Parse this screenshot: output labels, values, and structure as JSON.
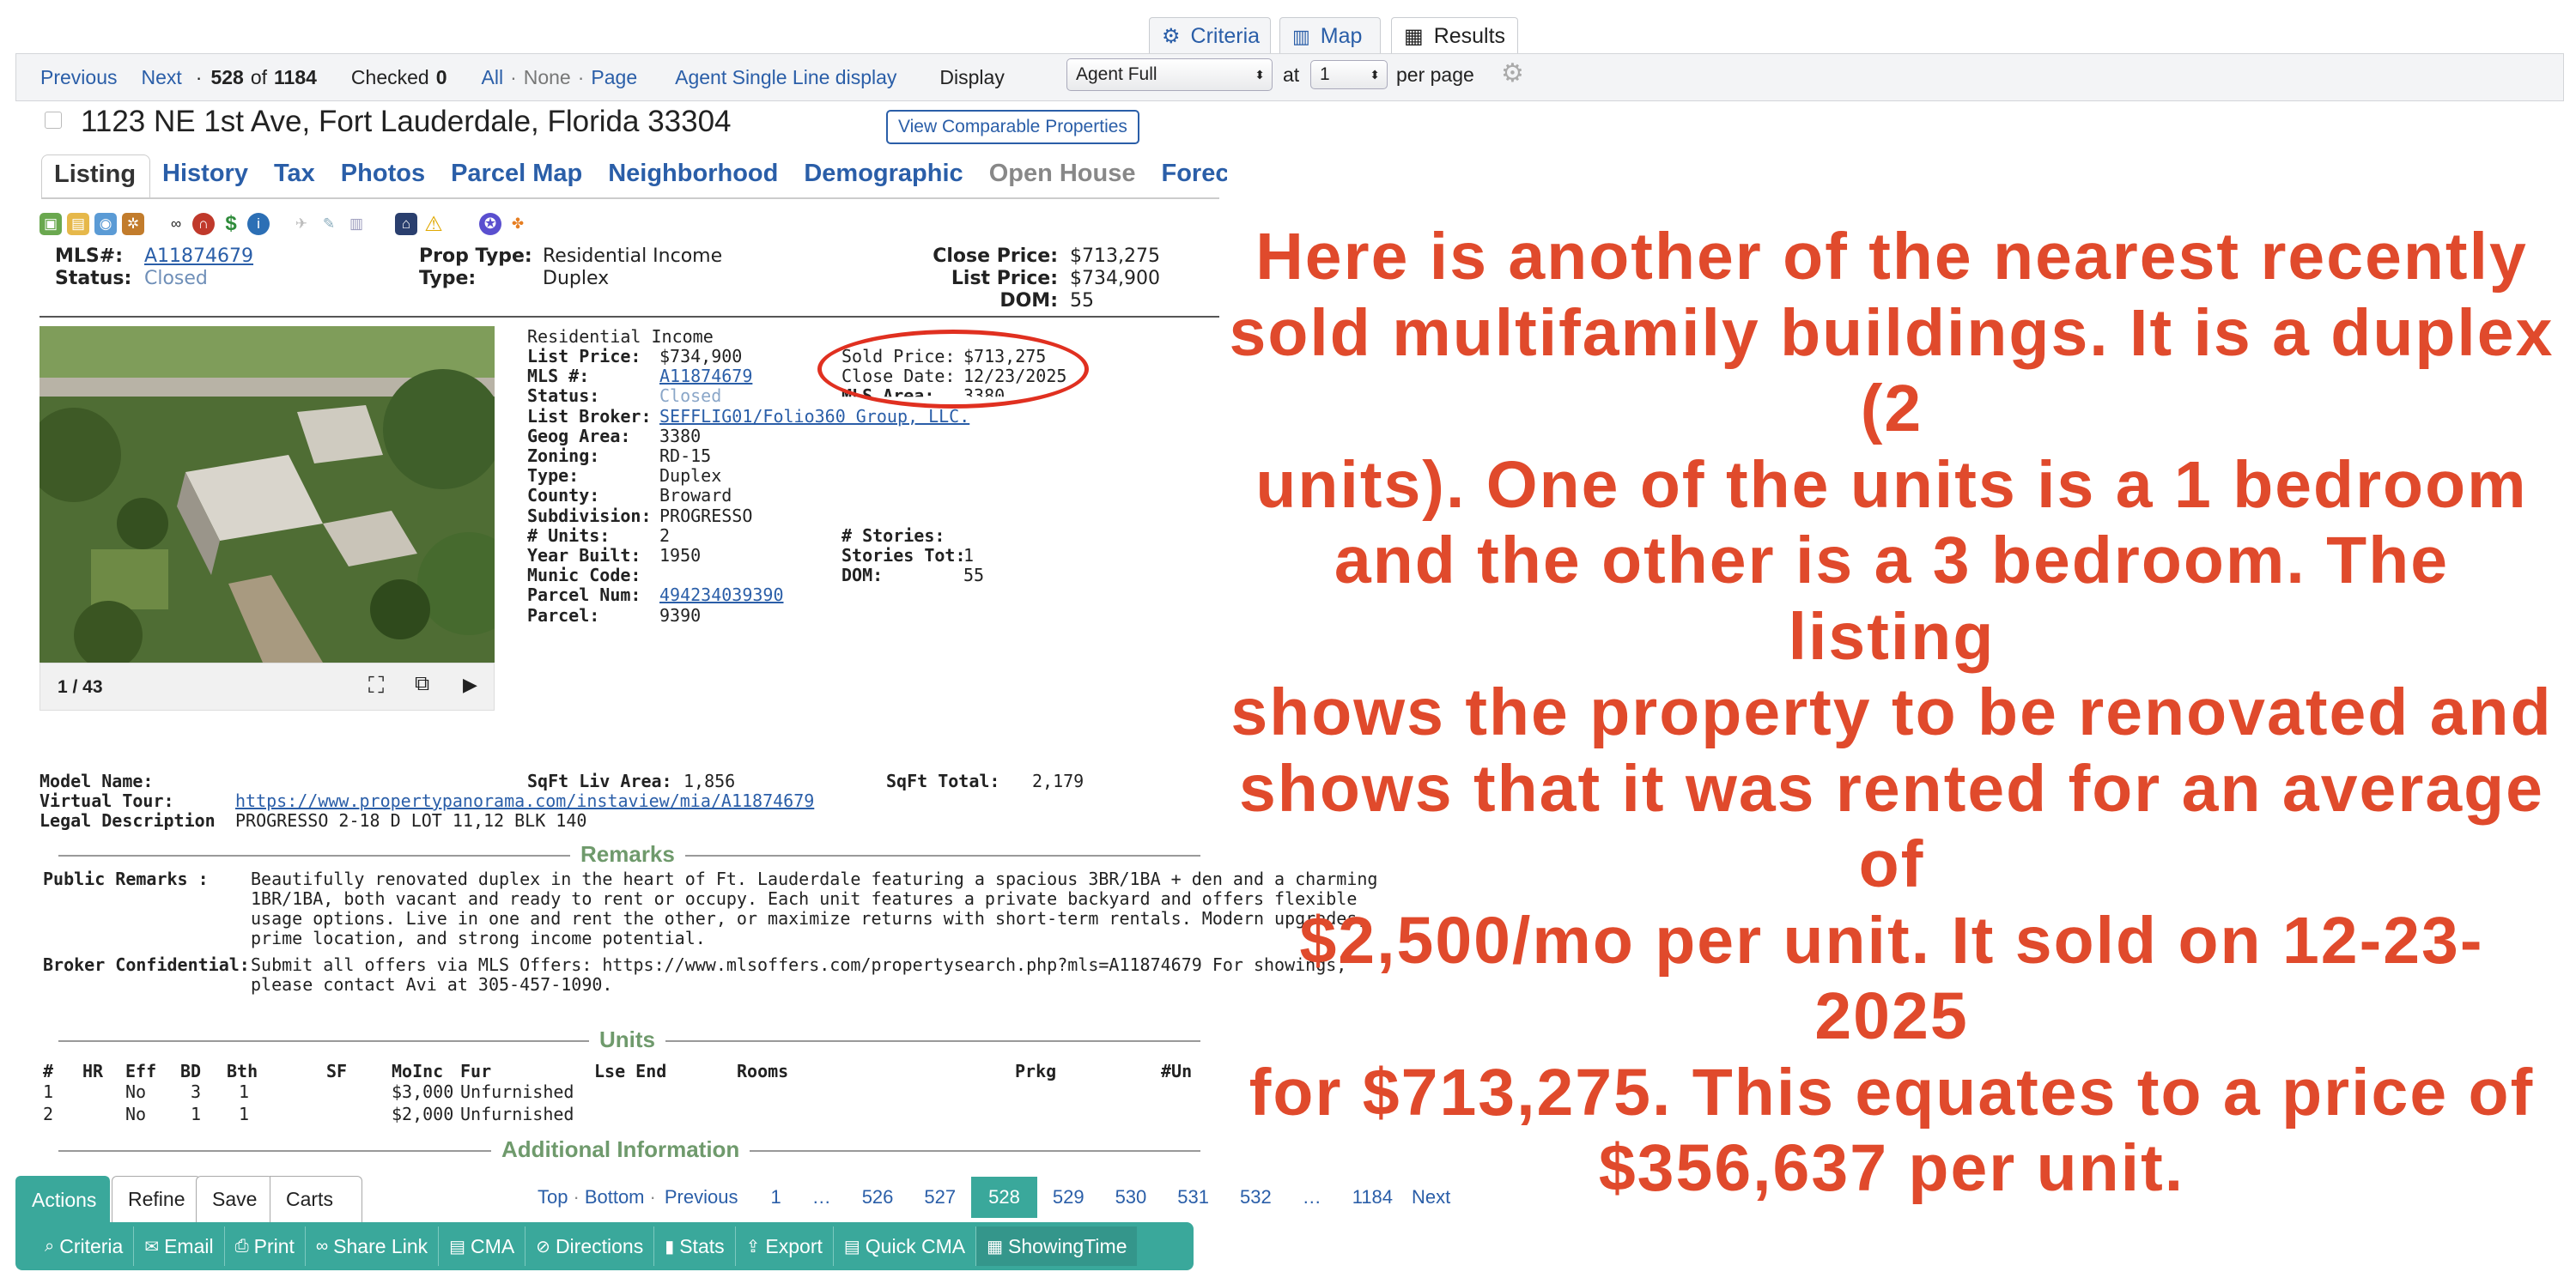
{
  "top_tabs": [
    {
      "label": "Criteria",
      "icon": "sliders-icon"
    },
    {
      "label": "Map",
      "icon": "map-icon"
    },
    {
      "label": "Results",
      "icon": "table-icon"
    }
  ],
  "toolbar": {
    "previous": "Previous",
    "next": "Next",
    "dot": "·",
    "position": "528",
    "of": "of",
    "total": "1184",
    "checked_label": "Checked",
    "checked_count": "0",
    "all": "All",
    "none": "None",
    "page": "Page",
    "sep": "·",
    "agent_single": "Agent Single Line display",
    "display_label": "Display",
    "display_value": "Agent Full",
    "at_label": "at",
    "per_page_value": "1",
    "per_page_label": "per page"
  },
  "property": {
    "address": "1123 NE 1st Ave, Fort Lauderdale, Florida 33304",
    "compare_button": "View Comparable Properties"
  },
  "property_tabs": [
    "Listing",
    "History",
    "Tax",
    "Photos",
    "Parcel Map",
    "Neighborhood",
    "Demographic",
    "Open House",
    "Foreclo"
  ],
  "summary": {
    "mls_label": "MLS#:",
    "mls_value": "A11874679",
    "status_label": "Status:",
    "status_value": "Closed",
    "proptype_label": "Prop Type:",
    "proptype_value": "Residential Income",
    "type_label": "Type:",
    "type_value": "Duplex",
    "close_price_label": "Close Price:",
    "close_price_value": "$713,275",
    "list_price_label": "List Price:",
    "list_price_value": "$734,900",
    "dom_label": "DOM:",
    "dom_value": "55"
  },
  "photo": {
    "counter": "1 / 43"
  },
  "details": {
    "category": "Residential Income",
    "left": [
      {
        "label": "List Price:",
        "value": "$734,900"
      },
      {
        "label": "MLS #:",
        "value": "A11874679",
        "link": true
      },
      {
        "label": "Status:",
        "value": "Closed",
        "muted": true
      },
      {
        "label": "List Broker:",
        "value": "SEFFLIG01/Folio360 Group, LLC.",
        "link": true
      },
      {
        "label": "Geog Area:",
        "value": "3380"
      },
      {
        "label": "Zoning:",
        "value": "RD-15"
      },
      {
        "label": "Type:",
        "value": "Duplex"
      },
      {
        "label": "County:",
        "value": "Broward"
      },
      {
        "label": "Subdivision:",
        "value": "PROGRESSO"
      },
      {
        "label": "# Units:",
        "value": "2"
      },
      {
        "label": "Year Built:",
        "value": "1950"
      },
      {
        "label": "Munic Code:",
        "value": ""
      },
      {
        "label": "Parcel Num:",
        "value": "494234039390",
        "link": true
      },
      {
        "label": "Parcel:",
        "value": "9390"
      }
    ],
    "sold_price_label": "Sold Price:",
    "sold_price_value": "$713,275",
    "close_date_label": "Close Date:",
    "close_date_value": "12/23/2025",
    "mls_area_label": "MLS Area:",
    "mls_area_value": "3380",
    "stories_label": "# Stories:",
    "stories_value": "",
    "stories_tot_label": "Stories Tot:",
    "stories_tot_value": "1",
    "dom_label": "DOM:",
    "dom_value": "55"
  },
  "extra": {
    "model_label": "Model Name:",
    "model_value": "",
    "tour_label": "Virtual Tour:",
    "tour_value": "https://www.propertypanorama.com/instaview/mia/A11874679",
    "legal_label": "Legal Description",
    "legal_value": "PROGRESSO 2-18 D LOT 11,12 BLK 140",
    "sqft_liv_label": "SqFt Liv Area:",
    "sqft_liv_value": "1,856",
    "sqft_total_label": "SqFt Total:",
    "sqft_total_value": "2,179"
  },
  "remarks": {
    "title": "Remarks",
    "public_label": "Public Remarks :",
    "public_lines": [
      "Beautifully renovated duplex in the heart of Ft. Lauderdale featuring a spacious 3BR/1BA + den and a charming",
      "1BR/1BA, both vacant and ready to rent or occupy. Each unit features a private backyard and offers flexible",
      "usage options. Live in one and rent the other, or maximize returns with short-term rentals. Modern upgrades,",
      "prime location, and strong income potential."
    ],
    "broker_label": "Broker Confidential:",
    "broker_lines": [
      "Submit all offers via MLS Offers: https://www.mlsoffers.com/propertysearch.php?mls=A11874679 For showings,",
      "please contact Avi at 305-457-1090."
    ]
  },
  "units": {
    "title": "Units",
    "headers": [
      "#",
      "HR",
      "Eff",
      "BD",
      "Bth",
      "SF",
      "MoInc",
      "Fur",
      "Lse End",
      "Rooms",
      "Prkg",
      "#Un"
    ],
    "rows": [
      [
        "1",
        "",
        "No",
        "3",
        "1",
        "",
        "$3,000",
        "Unfurnished",
        "",
        "",
        "",
        ""
      ],
      [
        "2",
        "",
        "No",
        "1",
        "1",
        "",
        "$2,000",
        "Unfurnished",
        "",
        "",
        "",
        ""
      ]
    ]
  },
  "additional": {
    "title": "Additional Information"
  },
  "annotation": "Here is another of the nearest recently sold multifamily buildings. It is a duplex (2 units). One of the units is a 1 bedroom and the other is a 3 bedroom. The listing shows the property to be renovated and shows that it was rented for an average of $2,500/mo per unit. It sold on 12-23-2025 for $713,275. This equates to a price of $356,637 per unit.",
  "annotation_lines": [
    "Here is another of the nearest recently",
    "sold multifamily buildings. It is a duplex (2",
    "units). One of the units is a 1 bedroom",
    "and the other is a 3 bedroom. The listing",
    "shows the property to be renovated and",
    "shows that it was rented for an average of",
    "$2,500/mo per unit. It sold on 12-23-2025",
    "for $713,275. This equates to a price of",
    "$356,637 per unit."
  ],
  "actions": {
    "tabs": [
      "Actions",
      "Refine",
      "Save",
      "Carts"
    ],
    "buttons": [
      {
        "label": "Criteria",
        "icon": "search-icon"
      },
      {
        "label": "Email",
        "icon": "email-icon"
      },
      {
        "label": "Print",
        "icon": "printer-icon"
      },
      {
        "label": "Share Link",
        "icon": "link-icon"
      },
      {
        "label": "CMA",
        "icon": "document-icon"
      },
      {
        "label": "Directions",
        "icon": "compass-icon"
      },
      {
        "label": "Stats",
        "icon": "bar-chart-icon"
      },
      {
        "label": "Export",
        "icon": "export-icon"
      },
      {
        "label": "Quick CMA",
        "icon": "document-icon"
      },
      {
        "label": "ShowingTime",
        "icon": "calendar-icon"
      }
    ]
  },
  "pager": {
    "top": "Top",
    "bottom": "Bottom",
    "sep": "·",
    "previous": "Previous",
    "pages": [
      "1",
      "…",
      "526",
      "527",
      "528",
      "529",
      "530",
      "531",
      "532",
      "…",
      "1184"
    ],
    "current": "528",
    "next": "Next"
  },
  "colors": {
    "link": "#2a5ea8",
    "accent": "#3aa89b",
    "annotation": "#e04a2c",
    "section": "#6f9a6c"
  }
}
